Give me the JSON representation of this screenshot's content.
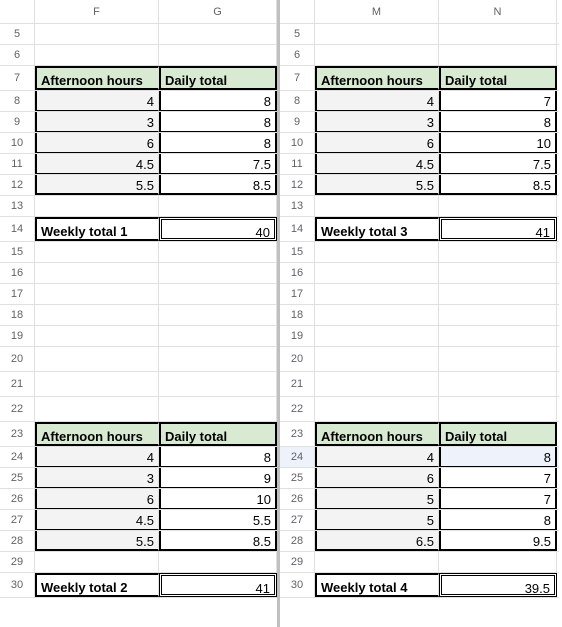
{
  "columns": {
    "left": [
      "F",
      "G"
    ],
    "right": [
      "M",
      "N"
    ]
  },
  "row_numbers": [
    5,
    6,
    7,
    8,
    9,
    10,
    11,
    12,
    13,
    14,
    15,
    16,
    17,
    18,
    19,
    20,
    21,
    22,
    23,
    24,
    25,
    26,
    27,
    28,
    29,
    30
  ],
  "headers": {
    "afternoon": "Afternoon hours",
    "daily": "Daily total"
  },
  "chart_data": [
    {
      "type": "table",
      "title": "Weekly total 1",
      "columns": [
        "Afternoon hours",
        "Daily total"
      ],
      "rows": [
        [
          4,
          8
        ],
        [
          3,
          8
        ],
        [
          6,
          8
        ],
        [
          4.5,
          7.5
        ],
        [
          5.5,
          8.5
        ]
      ],
      "weekly_total": 40
    },
    {
      "type": "table",
      "title": "Weekly total 2",
      "columns": [
        "Afternoon hours",
        "Daily total"
      ],
      "rows": [
        [
          4,
          8
        ],
        [
          3,
          9
        ],
        [
          6,
          10
        ],
        [
          4.5,
          5.5
        ],
        [
          5.5,
          8.5
        ]
      ],
      "weekly_total": 41
    },
    {
      "type": "table",
      "title": "Weekly total 3",
      "columns": [
        "Afternoon hours",
        "Daily total"
      ],
      "rows": [
        [
          4,
          7
        ],
        [
          3,
          8
        ],
        [
          6,
          10
        ],
        [
          4.5,
          7.5
        ],
        [
          5.5,
          8.5
        ]
      ],
      "weekly_total": 41
    },
    {
      "type": "table",
      "title": "Weekly total 4",
      "columns": [
        "Afternoon hours",
        "Daily total"
      ],
      "rows": [
        [
          4,
          8
        ],
        [
          6,
          7
        ],
        [
          5,
          7
        ],
        [
          5,
          8
        ],
        [
          6.5,
          9.5
        ]
      ],
      "weekly_total": 39.5
    }
  ]
}
